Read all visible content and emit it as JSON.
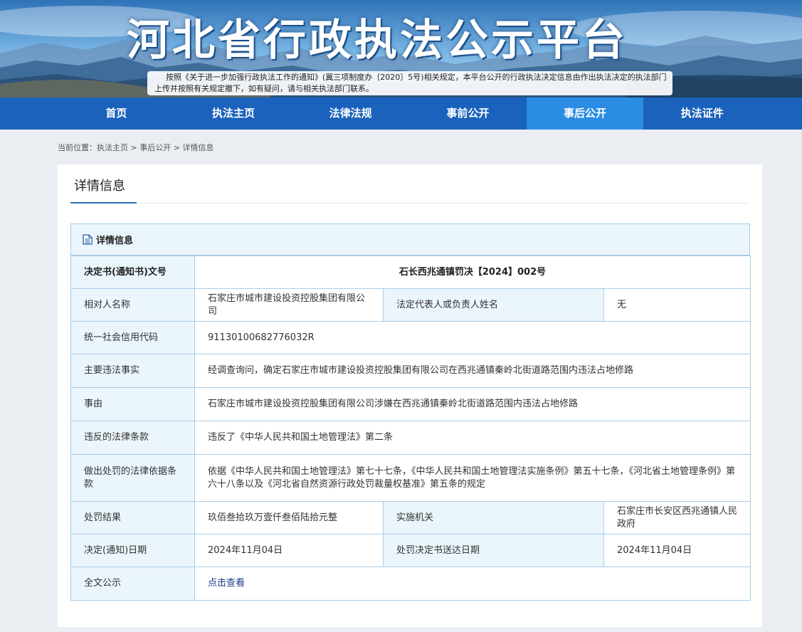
{
  "header": {
    "title": "河北省行政执法公示平台",
    "notice": "按照《关于进一步加强行政执法工作的通知》(冀三项制度办〔2020〕5号)相关规定，本平台公开的行政执法决定信息由作出执法决定的执法部门上传并按照有关规定撤下，如有疑问，请与相关执法部门联系。"
  },
  "nav": {
    "items": [
      "首页",
      "执法主页",
      "法律法规",
      "事前公开",
      "事后公开",
      "执法证件"
    ],
    "active_index": 4
  },
  "breadcrumb": "当前位置：执法主页 > 事后公开 > 详情信息",
  "card": {
    "title": "详情信息",
    "panel_title": "详情信息",
    "icon": "document-icon"
  },
  "detail": {
    "doc_no_label": "决定书(通知书)文号",
    "doc_no_value": "石长西兆通镇罚决【2024】002号",
    "party_label": "相对人名称",
    "party_value": "石家庄市城市建设投资控股集团有限公司",
    "legal_rep_label": "法定代表人或负责人姓名",
    "legal_rep_value": "无",
    "credit_code_label": "统一社会信用代码",
    "credit_code_value": "91130100682776032R",
    "facts_label": "主要违法事实",
    "facts_value": "经调查询问，确定石家庄市城市建设投资控股集团有限公司在西兆通镇秦岭北街道路范围内违法占地修路",
    "cause_label": "事由",
    "cause_value": "石家庄市城市建设投资控股集团有限公司涉嫌在西兆通镇秦岭北街道路范围内违法占地修路",
    "violated_label": "违反的法律条款",
    "violated_value": "违反了《中华人民共和国土地管理法》第二条",
    "basis_label": "做出处罚的法律依据条款",
    "basis_value": "依据《中华人民共和国土地管理法》第七十七条，《中华人民共和国土地管理法实施条例》第五十七条，《河北省土地管理条例》第六十八条以及《河北省自然资源行政处罚裁量权基准》第五条的规定",
    "result_label": "处罚结果",
    "result_value": "玖佰叁拾玖万壹仟叁佰陆拾元整",
    "agency_label": "实施机关",
    "agency_value": "石家庄市长安区西兆通镇人民政府",
    "date_label": "决定(通知)日期",
    "date_value": "2024年11月04日",
    "served_label": "处罚决定书送达日期",
    "served_value": "2024年11月04日",
    "fulltext_label": "全文公示",
    "fulltext_link": "点击查看"
  }
}
